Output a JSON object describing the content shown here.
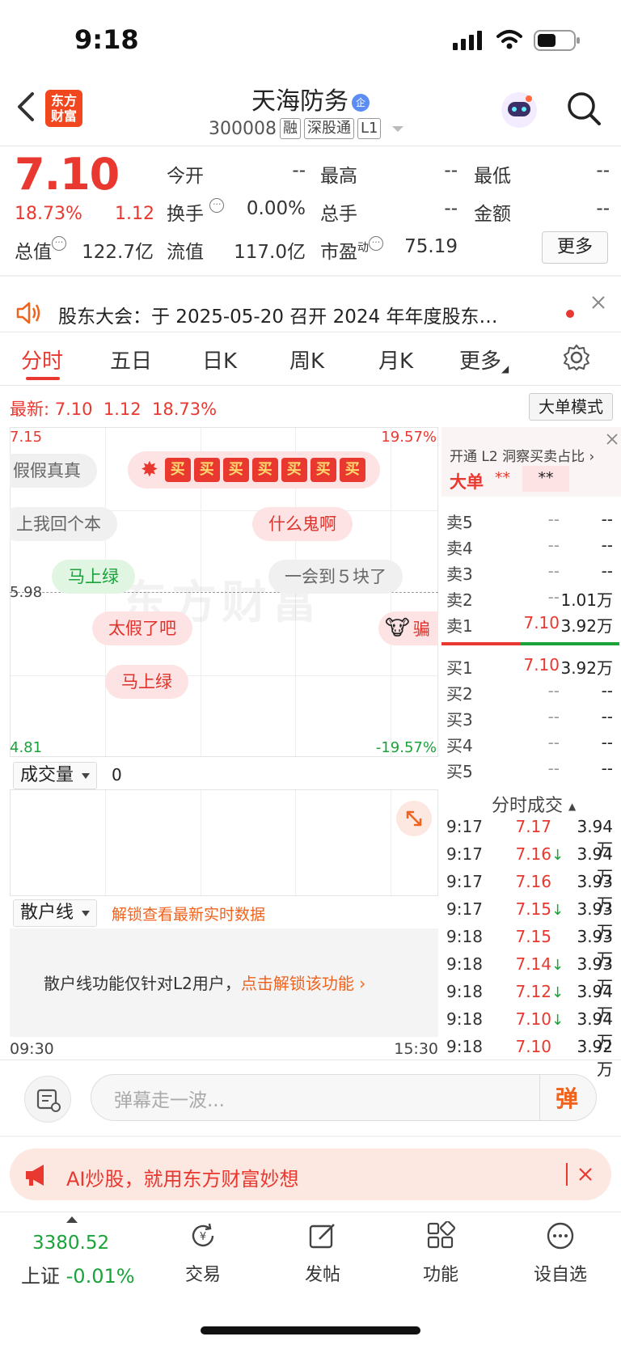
{
  "status_bar": {
    "time": "9:18"
  },
  "header": {
    "logo_text": "东方\n财富",
    "stock_name": "天海防务",
    "qi_badge": "企",
    "code": "300008",
    "tags": [
      "融",
      "深股通",
      "L1"
    ]
  },
  "quote": {
    "price": "7.10",
    "change_pct": "18.73%",
    "change": "1.12",
    "open_label": "今开",
    "open": "--",
    "high_label": "最高",
    "high": "--",
    "low_label": "最低",
    "low": "--",
    "turnover_label": "换手",
    "turnover": "0.00%",
    "volume_label": "总手",
    "volume": "--",
    "amount_label": "金额",
    "amount": "--",
    "mktcap_label": "总值",
    "mktcap": "122.7亿",
    "float_label": "流值",
    "float": "117.0亿",
    "pe_label": "市盈",
    "pe_sup": "动",
    "pe": "75.19",
    "more": "更多"
  },
  "notice": {
    "text": "股东大会：于 2025-05-20 召开 2024 年年度股东…"
  },
  "tabs": [
    "分时",
    "五日",
    "日K",
    "周K",
    "月K",
    "更多"
  ],
  "chart": {
    "latest_label": "最新:",
    "latest_price": "7.10",
    "latest_change": "1.12",
    "latest_pct": "18.73%",
    "mode_button": "大单模式",
    "y_top": "7.15",
    "y_top_pct": "19.57%",
    "y_mid": "5.98",
    "y_bottom": "4.81",
    "y_bottom_pct": "-19.57%",
    "danmu": [
      "假假真真",
      "上我回个本",
      "什么鬼啊",
      "马上绿",
      "一会到５块了",
      "太假了吧",
      "马上绿",
      "骗"
    ],
    "buy_char": "买",
    "volume_label": "成交量",
    "volume_value": "0",
    "retail_label": "散户线",
    "unlock_link": "解锁查看最新实时数据",
    "locked_text": "散户线功能仅针对L2用户，",
    "locked_link": "点击解锁该功能",
    "time_start": "09:30",
    "time_end": "15:30",
    "colors": {
      "up": "#e8382f",
      "down": "#1aa33a"
    }
  },
  "orderbook": {
    "promo": "开通 L2 洞察买卖占比",
    "big_label": "大单",
    "big_val1": "**",
    "big_val2": "**",
    "asks": [
      {
        "label": "卖5",
        "price": "--",
        "vol": "--"
      },
      {
        "label": "卖4",
        "price": "--",
        "vol": "--"
      },
      {
        "label": "卖3",
        "price": "--",
        "vol": "--"
      },
      {
        "label": "卖2",
        "price": "--",
        "vol": "1.01万"
      },
      {
        "label": "卖1",
        "price": "7.10",
        "vol": "3.92万"
      }
    ],
    "bids": [
      {
        "label": "买1",
        "price": "7.10",
        "vol": "3.92万"
      },
      {
        "label": "买2",
        "price": "--",
        "vol": "--"
      },
      {
        "label": "买3",
        "price": "--",
        "vol": "--"
      },
      {
        "label": "买4",
        "price": "--",
        "vol": "--"
      },
      {
        "label": "买5",
        "price": "--",
        "vol": "--"
      }
    ],
    "trades_label": "分时成交",
    "trades": [
      {
        "time": "9:17",
        "price": "7.17",
        "down": false,
        "vol": "3.94万"
      },
      {
        "time": "9:17",
        "price": "7.16",
        "down": true,
        "vol": "3.94万"
      },
      {
        "time": "9:17",
        "price": "7.16",
        "down": false,
        "vol": "3.93万"
      },
      {
        "time": "9:17",
        "price": "7.15",
        "down": true,
        "vol": "3.93万"
      },
      {
        "time": "9:18",
        "price": "7.15",
        "down": false,
        "vol": "3.93万"
      },
      {
        "time": "9:18",
        "price": "7.14",
        "down": true,
        "vol": "3.93万"
      },
      {
        "time": "9:18",
        "price": "7.12",
        "down": true,
        "vol": "3.94万"
      },
      {
        "time": "9:18",
        "price": "7.10",
        "down": true,
        "vol": "3.94万"
      },
      {
        "time": "9:18",
        "price": "7.10",
        "down": false,
        "vol": "3.92万"
      }
    ]
  },
  "danmu_input": {
    "placeholder": "弹幕走一波...",
    "send_char": "弹"
  },
  "ad": {
    "text": "AI炒股，就用东方财富妙想"
  },
  "bottom_nav": {
    "index_value": "3380.52",
    "index_name": "上证",
    "index_change": "-0.01%",
    "items": [
      "交易",
      "发帖",
      "功能",
      "设自选"
    ]
  }
}
